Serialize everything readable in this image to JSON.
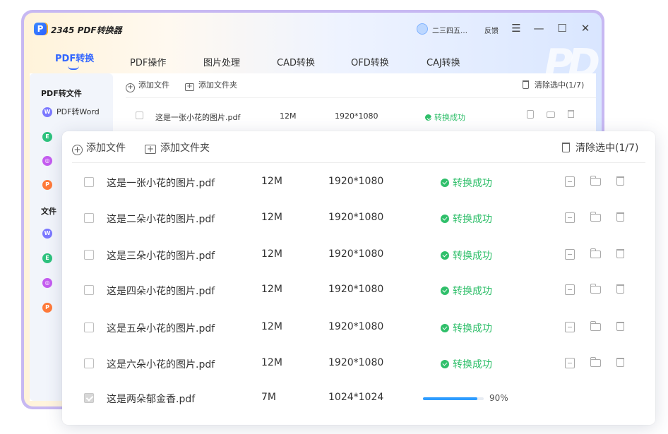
{
  "app": {
    "title": "2345 PDF转换器",
    "user_name": "二三四五…",
    "feedback": "反馈"
  },
  "tabs": [
    "PDF转换",
    "PDF操作",
    "图片处理",
    "CAD转换",
    "OFD转换",
    "CAJ转换"
  ],
  "sidebar": {
    "section1_title": "PDF转文件",
    "item1": "PDF转Word",
    "section2_title": "文件"
  },
  "back_toolbar": {
    "add_file": "添加文件",
    "add_folder": "添加文件夹",
    "clear": "清除选中(1/7)"
  },
  "back_row": {
    "name": "这是一张小花的图片.pdf",
    "size": "12M",
    "resolution": "1920*1080",
    "status": "转换成功"
  },
  "toolbar": {
    "add_file": "添加文件",
    "add_folder": "添加文件夹",
    "clear": "清除选中(1/7)"
  },
  "files": [
    {
      "name": "这是一张小花的图片.pdf",
      "size": "12M",
      "resolution": "1920*1080",
      "status": "转换成功"
    },
    {
      "name": "这是二朵小花的图片.pdf",
      "size": "12M",
      "resolution": "1920*1080",
      "status": "转换成功"
    },
    {
      "name": "这是三朵小花的图片.pdf",
      "size": "12M",
      "resolution": "1920*1080",
      "status": "转换成功"
    },
    {
      "name": "这是四朵小花的图片.pdf",
      "size": "12M",
      "resolution": "1920*1080",
      "status": "转换成功"
    },
    {
      "name": "这是五朵小花的图片.pdf",
      "size": "12M",
      "resolution": "1920*1080",
      "status": "转换成功"
    },
    {
      "name": "这是六朵小花的图片.pdf",
      "size": "12M",
      "resolution": "1920*1080",
      "status": "转换成功"
    },
    {
      "name": "这是两朵郁金香.pdf",
      "size": "7M",
      "resolution": "1024*1024",
      "progress": 0.9,
      "progress_text": "90%",
      "checked": true
    }
  ],
  "colors": {
    "accent": "#3366ff",
    "success": "#2fbf6a",
    "progress": "#2d9cff"
  }
}
